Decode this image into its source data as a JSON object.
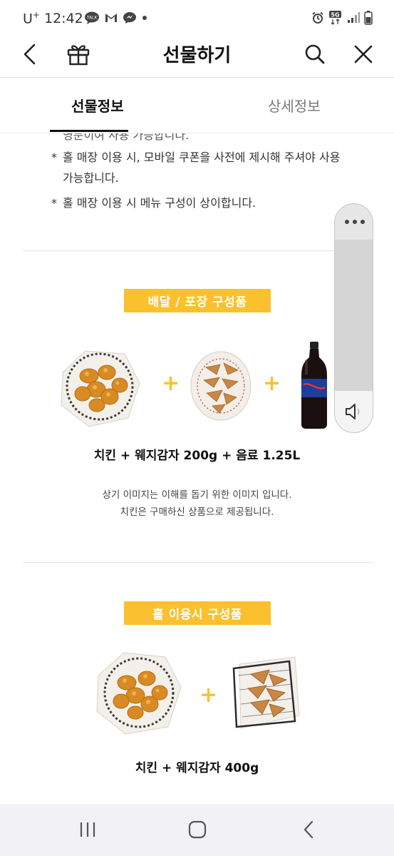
{
  "status_bar": {
    "carrier": "U",
    "carrier_sup": "+",
    "time": "12:42",
    "talk_label": "TALK",
    "network": "5G"
  },
  "header": {
    "title": "선물하기"
  },
  "tabs": [
    {
      "label": "선물정보",
      "active": true
    },
    {
      "label": "상세정보",
      "active": false
    }
  ],
  "notes": [
    {
      "bullet": "*",
      "text": "홀 매장 이용 시, 모바일 쿠폰을 사전에 제시해 주셔야 사용 가능합니다."
    },
    {
      "bullet": "*",
      "text": "홀 매장 이용 시 메뉴 구성이 상이합니다."
    }
  ],
  "cut_off_line": "영문이여 사용 가능합니다.",
  "section_delivery": {
    "badge": "배달 / 포장 구성품",
    "plus": "+",
    "caption": "치킨 + 웨지감자 200g + 음료 1.25L",
    "note_lines": [
      "상기 이미지는 이해를 돕기 위한 이미지 입니다.",
      "치킨은 구매하신 상품으로 제공됩니다."
    ]
  },
  "section_hall": {
    "badge": "홀 이용시 구성품",
    "plus": "+",
    "caption": "치킨 + 웨지감자 400g"
  },
  "colors": {
    "badge": "#fbc02d",
    "plus": "#f3c333",
    "cola_label": "#1f3d9a"
  }
}
